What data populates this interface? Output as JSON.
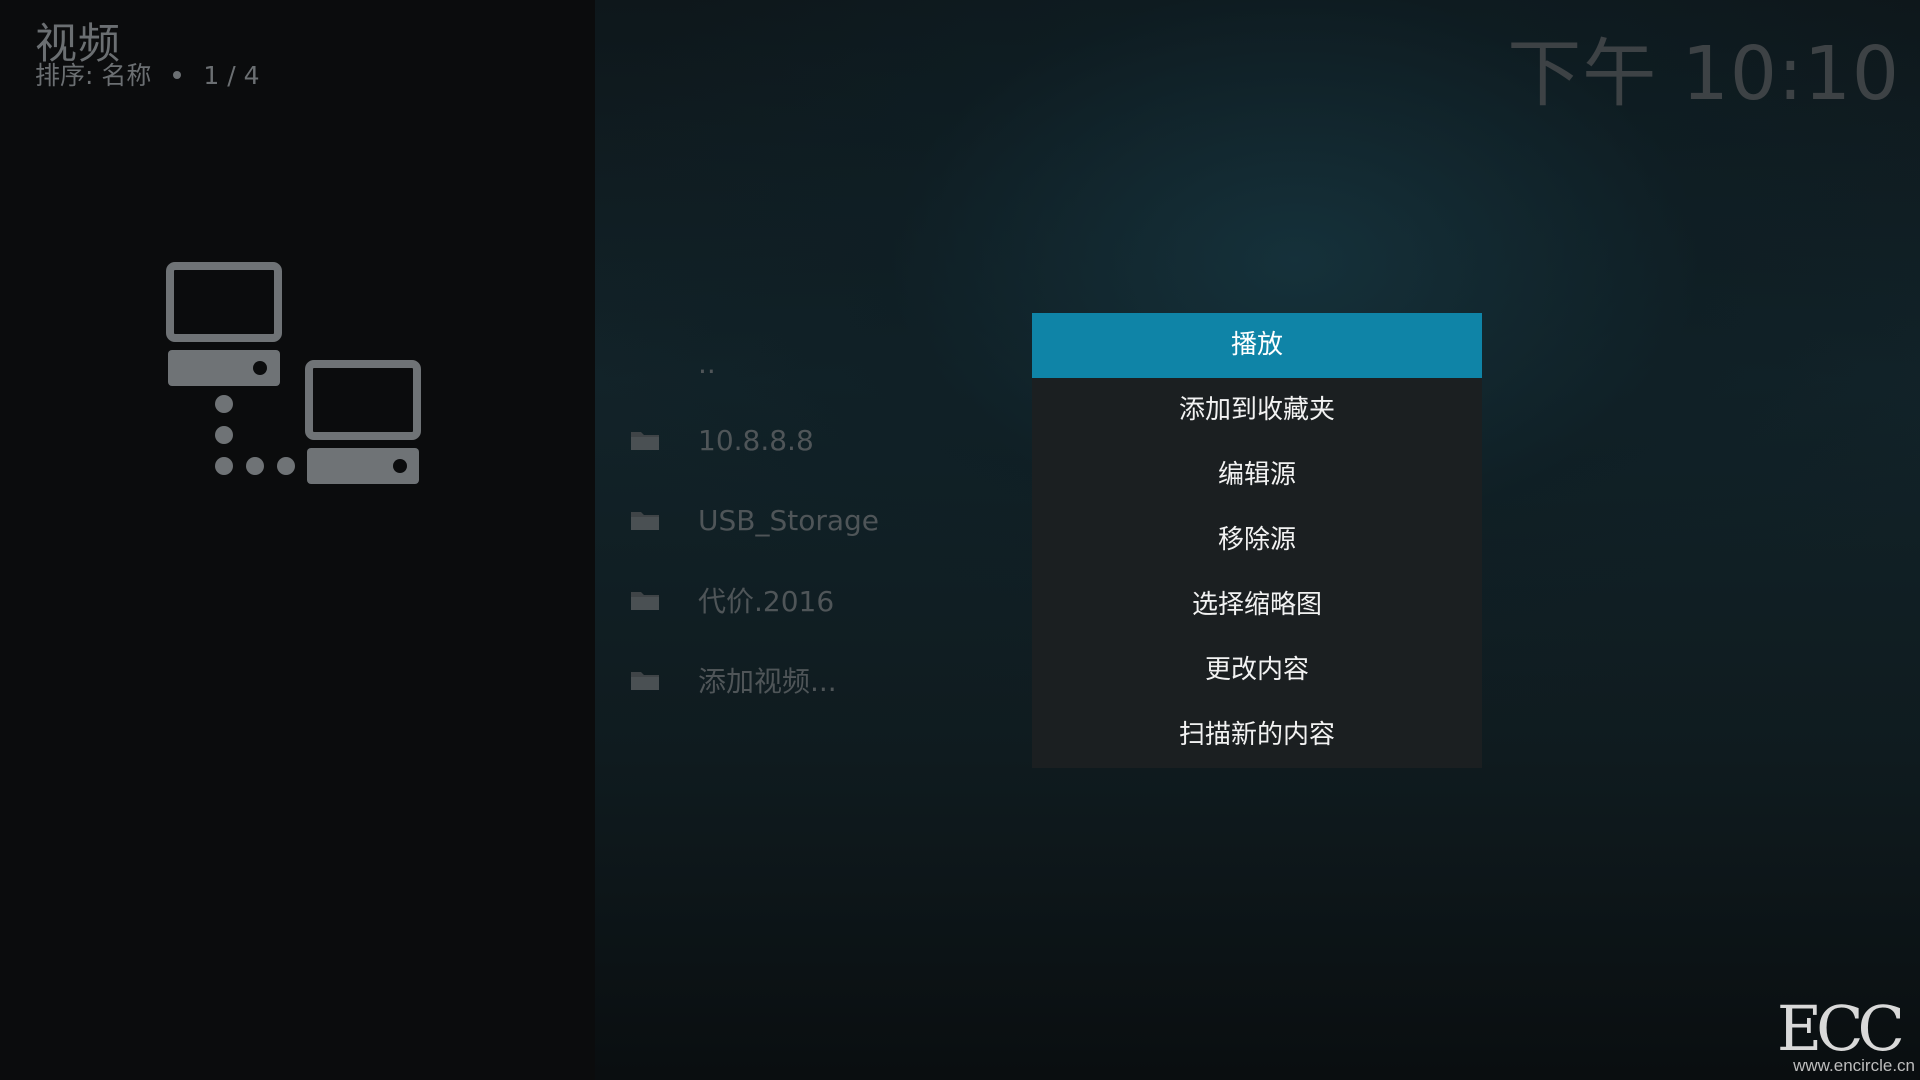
{
  "header": {
    "title": "视频",
    "sort_label": "排序: 名称",
    "page_indicator": "1 / 4"
  },
  "clock": "下午 10:10",
  "left_panel": {
    "icon": "network-computers-icon"
  },
  "file_list": {
    "items": [
      {
        "label": "..",
        "icon": "parent-folder"
      },
      {
        "label": "10.8.8.8",
        "icon": "folder-icon"
      },
      {
        "label": "USB_Storage",
        "icon": "folder-icon"
      },
      {
        "label": "代价.2016",
        "icon": "folder-icon"
      },
      {
        "label": "添加视频...",
        "icon": "folder-icon"
      }
    ]
  },
  "context_menu": {
    "items": [
      {
        "label": "播放",
        "selected": true
      },
      {
        "label": "添加到收藏夹",
        "selected": false
      },
      {
        "label": "编辑源",
        "selected": false
      },
      {
        "label": "移除源",
        "selected": false
      },
      {
        "label": "选择缩略图",
        "selected": false
      },
      {
        "label": "更改内容",
        "selected": false
      },
      {
        "label": "扫描新的内容",
        "selected": false
      }
    ]
  },
  "watermark": {
    "logo": "ECC",
    "url": "www.encircle.cn"
  },
  "colors": {
    "accent": "#0f84a7",
    "menu_bg": "#1b1f21",
    "muted_text": "#6b6f72",
    "list_text": "#4f5558"
  }
}
